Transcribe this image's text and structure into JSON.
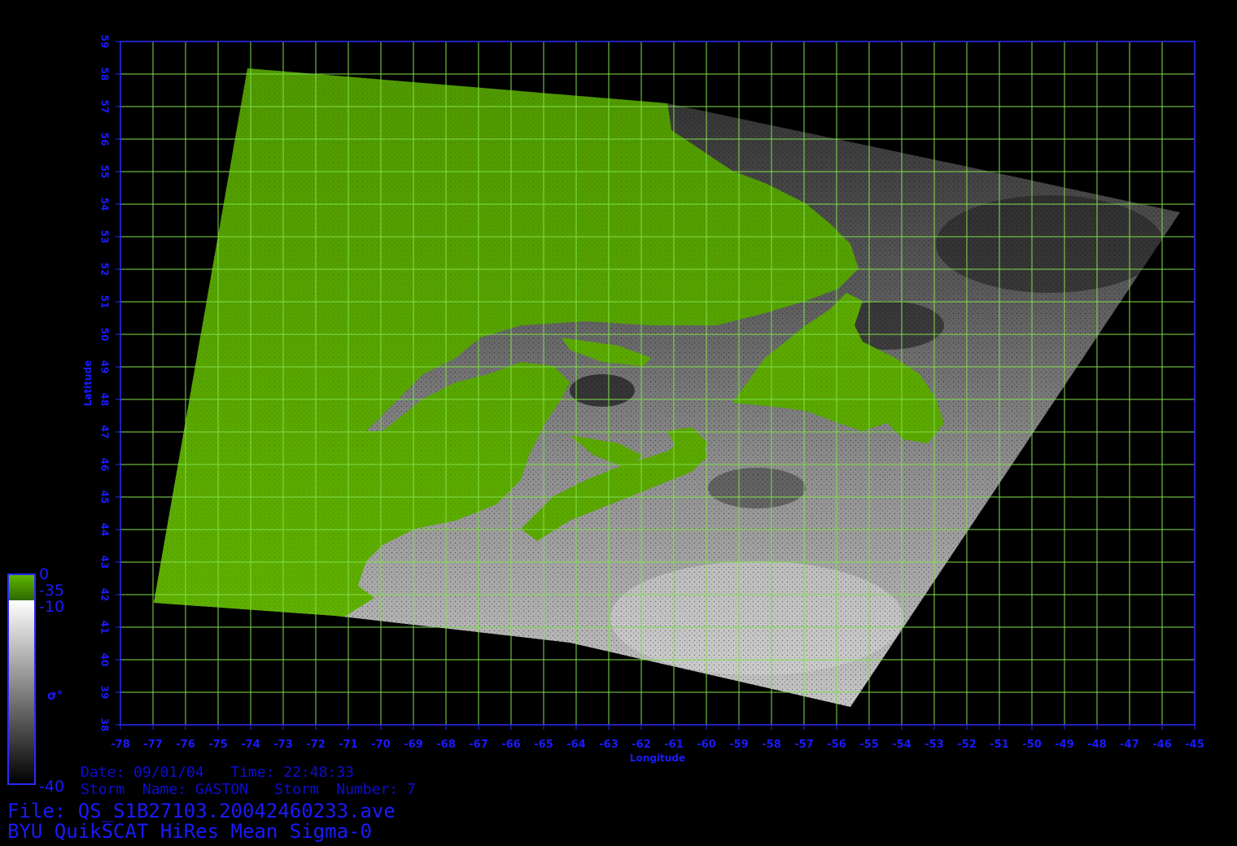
{
  "map": {
    "title": "BYU QuikSCAT HiRes Mean Sigma-0",
    "file": "File: QS_S1B27103.20042460233.ave",
    "date_line": "Date: 09/01/04   Time: 22:48:33",
    "storm_line": "Storm  Name: GASTON   Storm  Number: 7",
    "x_axis_label": "Longitude",
    "y_axis_label": "Latitude",
    "lon_range": [
      -78,
      -45
    ],
    "lat_range": [
      38,
      59
    ],
    "lon_ticks": [
      "-78",
      "-77",
      "-76",
      "-75",
      "-74",
      "-73",
      "-72",
      "-71",
      "-70",
      "-69",
      "-68",
      "-67",
      "-66",
      "-65",
      "-64",
      "-63",
      "-62",
      "-61",
      "-60",
      "-59",
      "-58",
      "-57",
      "-56",
      "-55",
      "-54",
      "-53",
      "-52",
      "-51",
      "-50",
      "-49",
      "-48",
      "-47",
      "-46",
      "-45"
    ],
    "lat_ticks": [
      "38",
      "39",
      "40",
      "41",
      "42",
      "43",
      "44",
      "45",
      "46",
      "47",
      "48",
      "49",
      "50",
      "51",
      "52",
      "53",
      "54",
      "55",
      "56",
      "57",
      "58",
      "59"
    ],
    "grid": true,
    "colors": {
      "background": "#000000",
      "axis": "#1a1aff",
      "grid": "#7fe04a",
      "land": "#5aa800",
      "ocean_dark": "#3c3c3c",
      "ocean_light": "#c8c8c8"
    }
  },
  "colorbar": {
    "symbol": "σ°",
    "land_max": "0",
    "land_min": "-35",
    "ocean_max": "-10",
    "ocean_min": "-40"
  }
}
